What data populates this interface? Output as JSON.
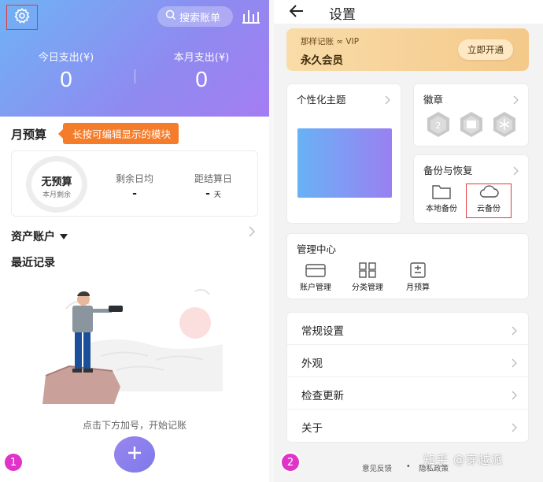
{
  "left": {
    "search_label": "搜索账单",
    "today_label": "今日支出(¥)",
    "today_value": "0",
    "month_label": "本月支出(¥)",
    "month_value": "0",
    "budget_title": "月预算",
    "tooltip": "长按可编辑显示的模块",
    "ring_main": "无预算",
    "ring_sub": "本月剩余",
    "col1_label": "剩余日均",
    "col1_value": "-",
    "col2_label": "距结算日",
    "col2_value": "-",
    "col2_unit": "天",
    "assets_label": "资产账户",
    "recent_label": "最近记录",
    "empty_hint": "点击下方加号，开始记账",
    "badge": "1"
  },
  "right": {
    "title": "设置",
    "vip_line1": "那样记账 ∞ VIP",
    "vip_line2": "永久会员",
    "vip_button": "立即开通",
    "theme_title": "个性化主题",
    "badges_title": "徽章",
    "backup_title": "备份与恢复",
    "local_backup": "本地备份",
    "cloud_backup": "云备份",
    "mgmt_title": "管理中心",
    "mgmt_items": [
      "账户管理",
      "分类管理",
      "月预算"
    ],
    "list_items": [
      "常规设置",
      "外观",
      "检查更新",
      "关于"
    ],
    "footer_left": "意见反馈",
    "footer_dot": "•",
    "footer_right": "隐私政策",
    "badge": "2",
    "watermark": "知乎 @穿越派"
  },
  "colors": {
    "hero_start": "#6fb3f5",
    "hero_end": "#a47df2",
    "accent_orange": "#f57c2b",
    "highlight_red": "#e23a3a",
    "badge_magenta": "#e033c9",
    "vip_gold": "#f4c98a"
  },
  "icons": [
    "gear-icon",
    "search-icon",
    "chart-bars-icon",
    "caret-down-icon",
    "chevron-right-icon",
    "plus-icon",
    "back-arrow-icon",
    "folder-icon",
    "cloud-icon",
    "card-icon",
    "grid-icon",
    "budget-icon",
    "medal-icon"
  ]
}
